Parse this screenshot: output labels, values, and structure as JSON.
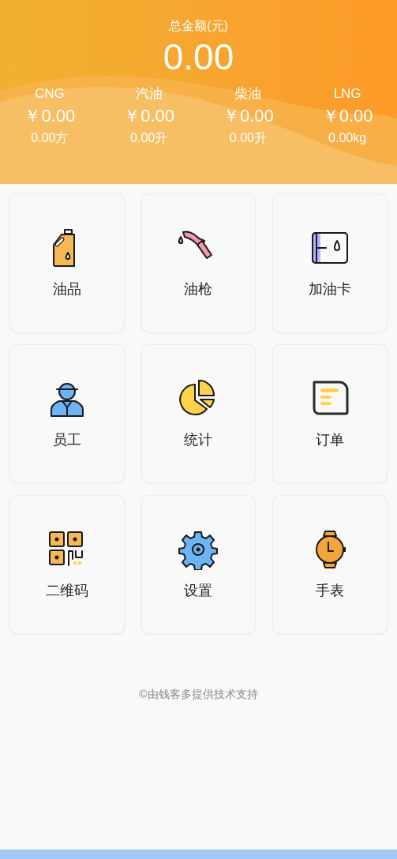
{
  "summary": {
    "title": "总金额(元)",
    "total": "0.00"
  },
  "fuels": [
    {
      "name": "CNG",
      "amount": "￥0.00",
      "volume": "0.00方"
    },
    {
      "name": "汽油",
      "amount": "￥0.00",
      "volume": "0.00升"
    },
    {
      "name": "柴油",
      "amount": "￥0.00",
      "volume": "0.00升"
    },
    {
      "name": "LNG",
      "amount": "￥0.00",
      "volume": "0.00kg"
    }
  ],
  "menu": [
    {
      "label": "油品",
      "kind": "canister"
    },
    {
      "label": "油枪",
      "kind": "nozzle"
    },
    {
      "label": "加油卡",
      "kind": "card"
    },
    {
      "label": "员工",
      "kind": "worker"
    },
    {
      "label": "统计",
      "kind": "pie"
    },
    {
      "label": "订单",
      "kind": "order"
    },
    {
      "label": "二维码",
      "kind": "qr"
    },
    {
      "label": "设置",
      "kind": "gear"
    },
    {
      "label": "手表",
      "kind": "watch"
    }
  ],
  "footer": "©由钱客多提供技术支持"
}
